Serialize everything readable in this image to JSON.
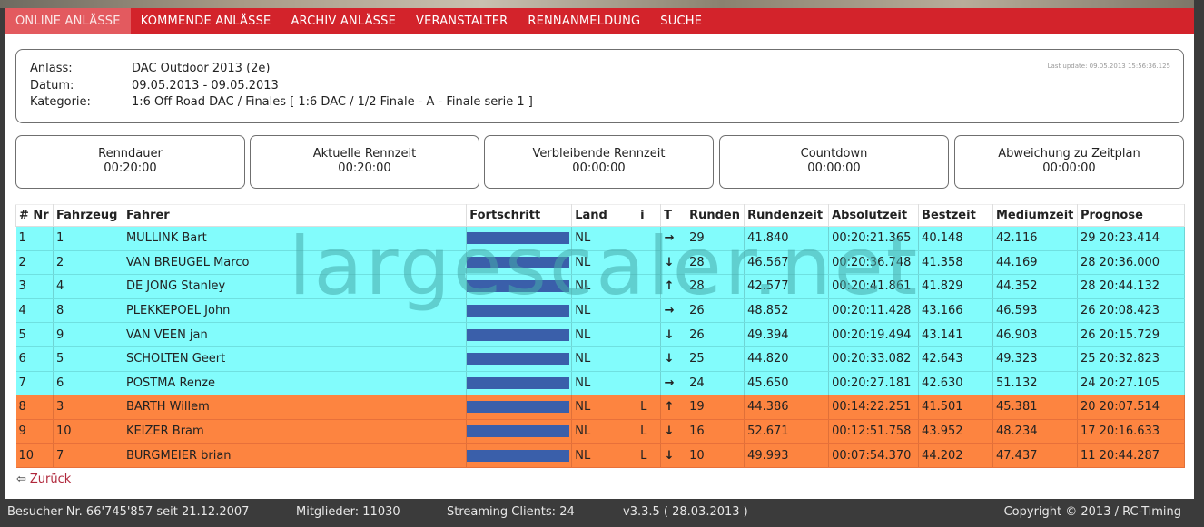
{
  "nav": {
    "items": [
      "ONLINE ANLÄSSE",
      "KOMMENDE ANLÄSSE",
      "ARCHIV ANLÄSSE",
      "VERANSTALTER",
      "RENNANMELDUNG",
      "SUCHE"
    ]
  },
  "info": {
    "anlass_label": "Anlass:",
    "anlass_value": "DAC Outdoor 2013 (2e)",
    "datum_label": "Datum:",
    "datum_value": "09.05.2013 - 09.05.2013",
    "kategorie_label": "Kategorie:",
    "kategorie_value": "1:6 Off Road DAC / Finales [ 1:6 DAC / 1/2 Finale - A - Finale serie 1 ]",
    "last_update": "Last update: 09.05.2013 15:56:36.125"
  },
  "timers": [
    {
      "label": "Renndauer",
      "value": "00:20:00"
    },
    {
      "label": "Aktuelle Rennzeit",
      "value": "00:20:00"
    },
    {
      "label": "Verbleibende Rennzeit",
      "value": "00:00:00"
    },
    {
      "label": "Countdown",
      "value": "00:00:00"
    },
    {
      "label": "Abweichung zu Zeitplan",
      "value": "00:00:00"
    }
  ],
  "table": {
    "headers": [
      "# Nr",
      "Fahrzeug",
      "Fahrer",
      "Fortschritt",
      "Land",
      "i",
      "T",
      "Runden",
      "Rundenzeit",
      "Absolutzeit",
      "Bestzeit",
      "Mediumzeit",
      "Prognose"
    ],
    "rows": [
      {
        "pos": "1",
        "fahrzeug": "1",
        "fahrer": "MULLINK Bart",
        "land": "NL",
        "i": "",
        "t": "→",
        "runden": "29",
        "rundenzeit": "41.840",
        "absolutzeit": "00:20:21.365",
        "bestzeit": "40.148",
        "mediumzeit": "42.116",
        "prognose": "29 20:23.414",
        "status": "cyan",
        "progress": 1.0
      },
      {
        "pos": "2",
        "fahrzeug": "2",
        "fahrer": "VAN BREUGEL Marco",
        "land": "NL",
        "i": "",
        "t": "↓",
        "runden": "28",
        "rundenzeit": "46.567",
        "absolutzeit": "00:20:36.748",
        "bestzeit": "41.358",
        "mediumzeit": "44.169",
        "prognose": "28 20:36.000",
        "status": "cyan",
        "progress": 1.0
      },
      {
        "pos": "3",
        "fahrzeug": "4",
        "fahrer": "DE JONG Stanley",
        "land": "NL",
        "i": "",
        "t": "↑",
        "runden": "28",
        "rundenzeit": "42.577",
        "absolutzeit": "00:20:41.861",
        "bestzeit": "41.829",
        "mediumzeit": "44.352",
        "prognose": "28 20:44.132",
        "status": "cyan",
        "progress": 1.0
      },
      {
        "pos": "4",
        "fahrzeug": "8",
        "fahrer": "PLEKKEPOEL John",
        "land": "NL",
        "i": "",
        "t": "→",
        "runden": "26",
        "rundenzeit": "48.852",
        "absolutzeit": "00:20:11.428",
        "bestzeit": "43.166",
        "mediumzeit": "46.593",
        "prognose": "26 20:08.423",
        "status": "cyan",
        "progress": 1.0
      },
      {
        "pos": "5",
        "fahrzeug": "9",
        "fahrer": "VAN VEEN jan",
        "land": "NL",
        "i": "",
        "t": "↓",
        "runden": "26",
        "rundenzeit": "49.394",
        "absolutzeit": "00:20:19.494",
        "bestzeit": "43.141",
        "mediumzeit": "46.903",
        "prognose": "26 20:15.729",
        "status": "cyan",
        "progress": 1.0
      },
      {
        "pos": "6",
        "fahrzeug": "5",
        "fahrer": "SCHOLTEN Geert",
        "land": "NL",
        "i": "",
        "t": "↓",
        "runden": "25",
        "rundenzeit": "44.820",
        "absolutzeit": "00:20:33.082",
        "bestzeit": "42.643",
        "mediumzeit": "49.323",
        "prognose": "25 20:32.823",
        "status": "cyan",
        "progress": 1.0
      },
      {
        "pos": "7",
        "fahrzeug": "6",
        "fahrer": "POSTMA Renze",
        "land": "NL",
        "i": "",
        "t": "→",
        "runden": "24",
        "rundenzeit": "45.650",
        "absolutzeit": "00:20:27.181",
        "bestzeit": "42.630",
        "mediumzeit": "51.132",
        "prognose": "24 20:27.105",
        "status": "cyan",
        "progress": 1.0
      },
      {
        "pos": "8",
        "fahrzeug": "3",
        "fahrer": "BARTH Willem",
        "land": "NL",
        "i": "L",
        "t": "↑",
        "runden": "19",
        "rundenzeit": "44.386",
        "absolutzeit": "00:14:22.251",
        "bestzeit": "41.501",
        "mediumzeit": "45.381",
        "prognose": "20 20:07.514",
        "status": "orange",
        "progress": 1.0
      },
      {
        "pos": "9",
        "fahrzeug": "10",
        "fahrer": "KEIZER Bram",
        "land": "NL",
        "i": "L",
        "t": "↓",
        "runden": "16",
        "rundenzeit": "52.671",
        "absolutzeit": "00:12:51.758",
        "bestzeit": "43.952",
        "mediumzeit": "48.234",
        "prognose": "17 20:16.633",
        "status": "orange",
        "progress": 1.0
      },
      {
        "pos": "10",
        "fahrzeug": "7",
        "fahrer": "BURGMEIER brian",
        "land": "NL",
        "i": "L",
        "t": "↓",
        "runden": "10",
        "rundenzeit": "49.993",
        "absolutzeit": "00:07:54.370",
        "bestzeit": "44.202",
        "mediumzeit": "47.437",
        "prognose": "11 20:44.287",
        "status": "orange",
        "progress": 1.0
      }
    ]
  },
  "back_label": "Zurück",
  "watermark": "largescaler.net",
  "footer": {
    "visitors": "Besucher Nr. 66'745'857 seit 21.12.2007",
    "members": "Mitglieder: 11030",
    "streaming": "Streaming Clients: 24",
    "version": "v3.3.5 ( 28.03.2013 )",
    "copyright": "Copyright © 2013 / RC-Timing"
  },
  "colors": {
    "nav_red": "#d3232b",
    "row_cyan": "#82fcfc",
    "row_orange": "#fd8440",
    "progress_bar": "#3a5faa",
    "footer_bg": "#3b3b3b"
  }
}
